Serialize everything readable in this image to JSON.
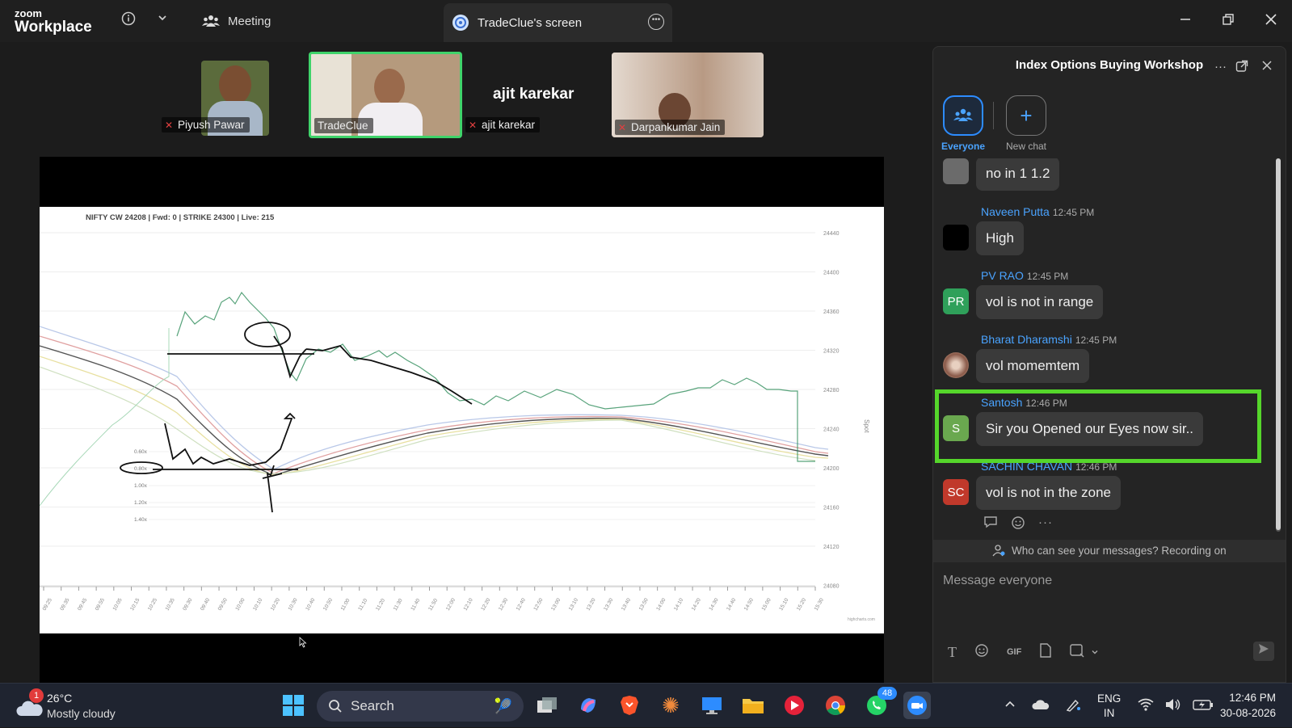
{
  "titlebar": {
    "brand_small": "zoom",
    "brand_big": "Workplace",
    "meeting_label": "Meeting",
    "screen_tab_label": "TradeClue's screen"
  },
  "participants": [
    {
      "name": "Piyush Pawar"
    },
    {
      "name": "TradeClue"
    },
    {
      "name": "ajit karekar",
      "display_name": "ajit karekar"
    },
    {
      "name": "Darpankumar Jain"
    }
  ],
  "shared_chart": {
    "header": "NIFTY CW 24208 | Fwd: 0 | STRIKE 24300 | Live: 215",
    "y_ticks": [
      "24440",
      "24400",
      "24360",
      "24320",
      "24280",
      "24240",
      "24200",
      "24160",
      "24120",
      "24080"
    ],
    "y_axis_label": "Spot",
    "level_labels": [
      "0.60x",
      "0.80x",
      "1.00x",
      "1.20x",
      "1.40x"
    ],
    "x_ticks": [
      "09:25",
      "09:35",
      "09:45",
      "09:55",
      "10:05",
      "10:15",
      "10:25",
      "10:35",
      "09:30",
      "09:40",
      "09:50",
      "10:00",
      "10:10",
      "10:20",
      "10:30",
      "10:40",
      "10:50",
      "11:00",
      "11:10",
      "11:20",
      "11:30",
      "11:40",
      "11:50",
      "12:00",
      "12:10",
      "12:20",
      "12:30",
      "12:40",
      "12:50",
      "13:00",
      "13:10",
      "13:20",
      "13:30",
      "13:40",
      "13:50",
      "14:00",
      "14:10",
      "14:20",
      "14:30",
      "14:40",
      "14:50",
      "15:00",
      "15:10",
      "15:20",
      "15:30"
    ],
    "watermark": "highcharts.com"
  },
  "chat": {
    "title": "Index Options Buying Workshop",
    "tabs": [
      {
        "label": "Everyone"
      },
      {
        "label": "New chat"
      }
    ],
    "messages": [
      {
        "sender": "",
        "time": "",
        "text": "no in 1 1.2",
        "avatar": "",
        "avatar_color": "#6b6b6b"
      },
      {
        "sender": "Naveen Putta",
        "time": "12:45 PM",
        "text": "High",
        "avatar": "",
        "avatar_color": "#000000"
      },
      {
        "sender": "PV RAO",
        "time": "12:45 PM",
        "text": "vol is not in range",
        "avatar": "PR",
        "avatar_color": "#2fa05a"
      },
      {
        "sender": "Bharat Dharamshi",
        "time": "12:45 PM",
        "text": "vol momemtem",
        "avatar": "",
        "avatar_color": "#8a6a5a"
      },
      {
        "sender": "Santosh",
        "time": "12:46 PM",
        "text": "Sir you Opened our Eyes now sir..",
        "avatar": "S",
        "avatar_color": "#6aa84f"
      },
      {
        "sender": "SACHIN CHAVAN",
        "time": "12:46 PM",
        "text": "vol is not in the zone",
        "avatar": "SC",
        "avatar_color": "#c0392b"
      }
    ],
    "notice": "Who can see your messages? Recording on",
    "compose_placeholder": "Message everyone",
    "toolbar_gif": "GIF"
  },
  "taskbar": {
    "weather_badge": "1",
    "temp": "26°C",
    "condition": "Mostly cloudy",
    "search_label": "Search",
    "whatsapp_badge": "48",
    "lang_top": "ENG",
    "lang_bottom": "IN",
    "time": "12:46 PM",
    "date": "30-08-2026"
  }
}
